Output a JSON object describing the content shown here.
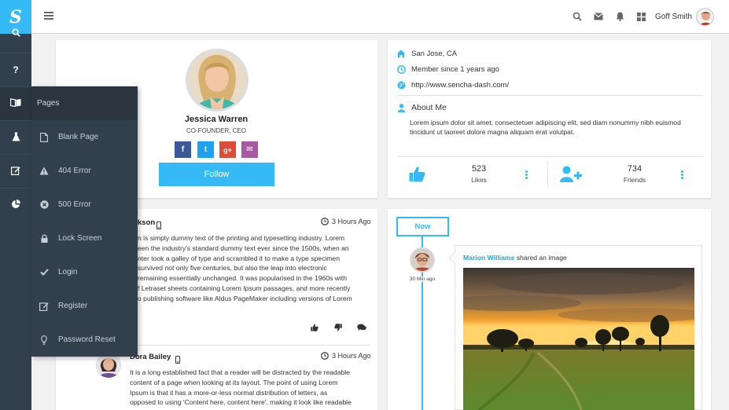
{
  "topbar": {
    "user_name": "Goff Smith"
  },
  "nav": {
    "items": [
      "search-icon",
      "help-icon",
      "book-icon",
      "flask-icon",
      "edit-icon",
      "pie-chart-icon"
    ]
  },
  "flyout": {
    "title": "Pages",
    "items": [
      {
        "label": "Blank Page",
        "icon": "file-icon"
      },
      {
        "label": "404 Error",
        "icon": "warning-icon"
      },
      {
        "label": "500 Error",
        "icon": "times-circle-icon"
      },
      {
        "label": "Lock Screen",
        "icon": "lock-icon"
      },
      {
        "label": "Login",
        "icon": "check-icon"
      },
      {
        "label": "Register",
        "icon": "edit-icon"
      },
      {
        "label": "Password Reset",
        "icon": "lightbulb-icon"
      }
    ]
  },
  "profile": {
    "name": "Jessica Warren",
    "title": "CO-FOUNDER, CEO",
    "follow_label": "Follow",
    "social": [
      "f",
      "t",
      "g+",
      "✉"
    ]
  },
  "info": {
    "location": "San Jose, CA",
    "member_since": "Member since 1 years ago",
    "website": "http://www.sencha-dash.com/",
    "about_title": "About Me",
    "about_text": "Lorem ipsum dolor sit amet, consectetuer adipiscing elit, sed diam nonummy nibh euismod tincidunt ut laoreet dolore magna aliquam erat volutpat.",
    "likes_count": "523",
    "likes_label": "Likes",
    "friends_count": "734",
    "friends_label": "Friends"
  },
  "posts": [
    {
      "author": "kson",
      "time": "3 Hours Ago",
      "lines": [
        "n is simply dummy text of the printing and typesetting industry. Lorem",
        "een the industry's standard dummy text ever since the 1500s, when an",
        "nter took a galley of type and scrambled it to make a type specimen",
        "survived not only five centuries, but also the leap into electronic",
        "remaining essentially unchanged. It was popularised in the 1960s with",
        "f Letraset sheets containing Lorem Ipsum passages, and more recently",
        "o publishing software like Aldus PageMaker including versions of Lorem"
      ]
    },
    {
      "author": "Dora Bailey",
      "time": "3 Hours Ago",
      "lines": [
        "It is a long established fact that a reader will be distracted by the readable",
        "content of a page when looking at its layout. The point of using Lorem",
        "Ipsum is that it has a more-or-less normal distribution of letters, as",
        "opposed to using 'Content here, content here', making it look like readable"
      ]
    }
  ],
  "timeline": {
    "now_label": "Now",
    "time": "30 Min ago",
    "author": "Marion Williams",
    "action": "shared an image"
  },
  "colors": {
    "accent": "#35baf6",
    "nav_bg": "#32404e",
    "facebook": "#3b5998",
    "twitter": "#1da1f2",
    "google": "#dd4b39",
    "email": "#a958a5"
  }
}
